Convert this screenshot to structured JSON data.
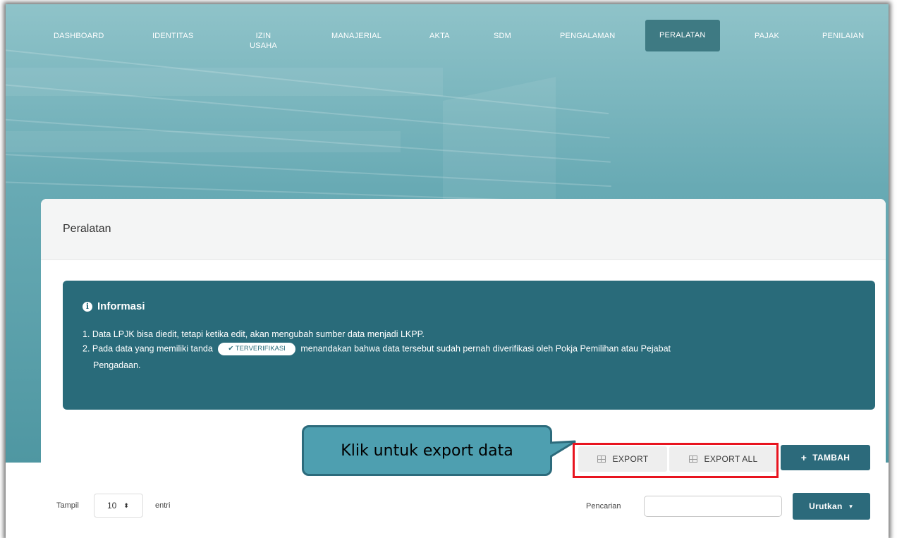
{
  "nav": {
    "items": [
      {
        "label": "DASHBOARD"
      },
      {
        "label": "IDENTITAS"
      },
      {
        "label": "IZIN\nUSAHA"
      },
      {
        "label": "MANAJERIAL"
      },
      {
        "label": "AKTA"
      },
      {
        "label": "SDM"
      },
      {
        "label": "PENGALAMAN"
      },
      {
        "label": "PERALATAN",
        "active": true
      },
      {
        "label": "PAJAK"
      },
      {
        "label": "PENILAIAN"
      }
    ]
  },
  "card": {
    "title": "Peralatan"
  },
  "info": {
    "title": "Informasi",
    "line1": "1. Data LPJK bisa diedit, tetapi ketika edit, akan mengubah sumber data menjadi LKPP.",
    "line2_before": "2. Pada data yang memiliki tanda",
    "badge": "TERVERIFIKASI",
    "line2_after": "menandakan bahwa data tersebut sudah pernah diverifikasi oleh Pokja Pemilihan atau Pejabat",
    "line3": "Pengadaan."
  },
  "actions": {
    "export_label": "EXPORT",
    "export_all_label": "EXPORT ALL",
    "add_label": "TAMBAH"
  },
  "callout": {
    "text": "Klik untuk export data"
  },
  "table_controls": {
    "show_label": "Tampil",
    "page_size": "10",
    "entries_label": "entri",
    "search_label": "Pencarian",
    "search_value": "",
    "sort_label": "Urutkan"
  },
  "colors": {
    "accent": "#2c6a7b",
    "info_bg": "#296b7a",
    "highlight": "#e8141f",
    "callout_bg": "#4e9fb0"
  }
}
